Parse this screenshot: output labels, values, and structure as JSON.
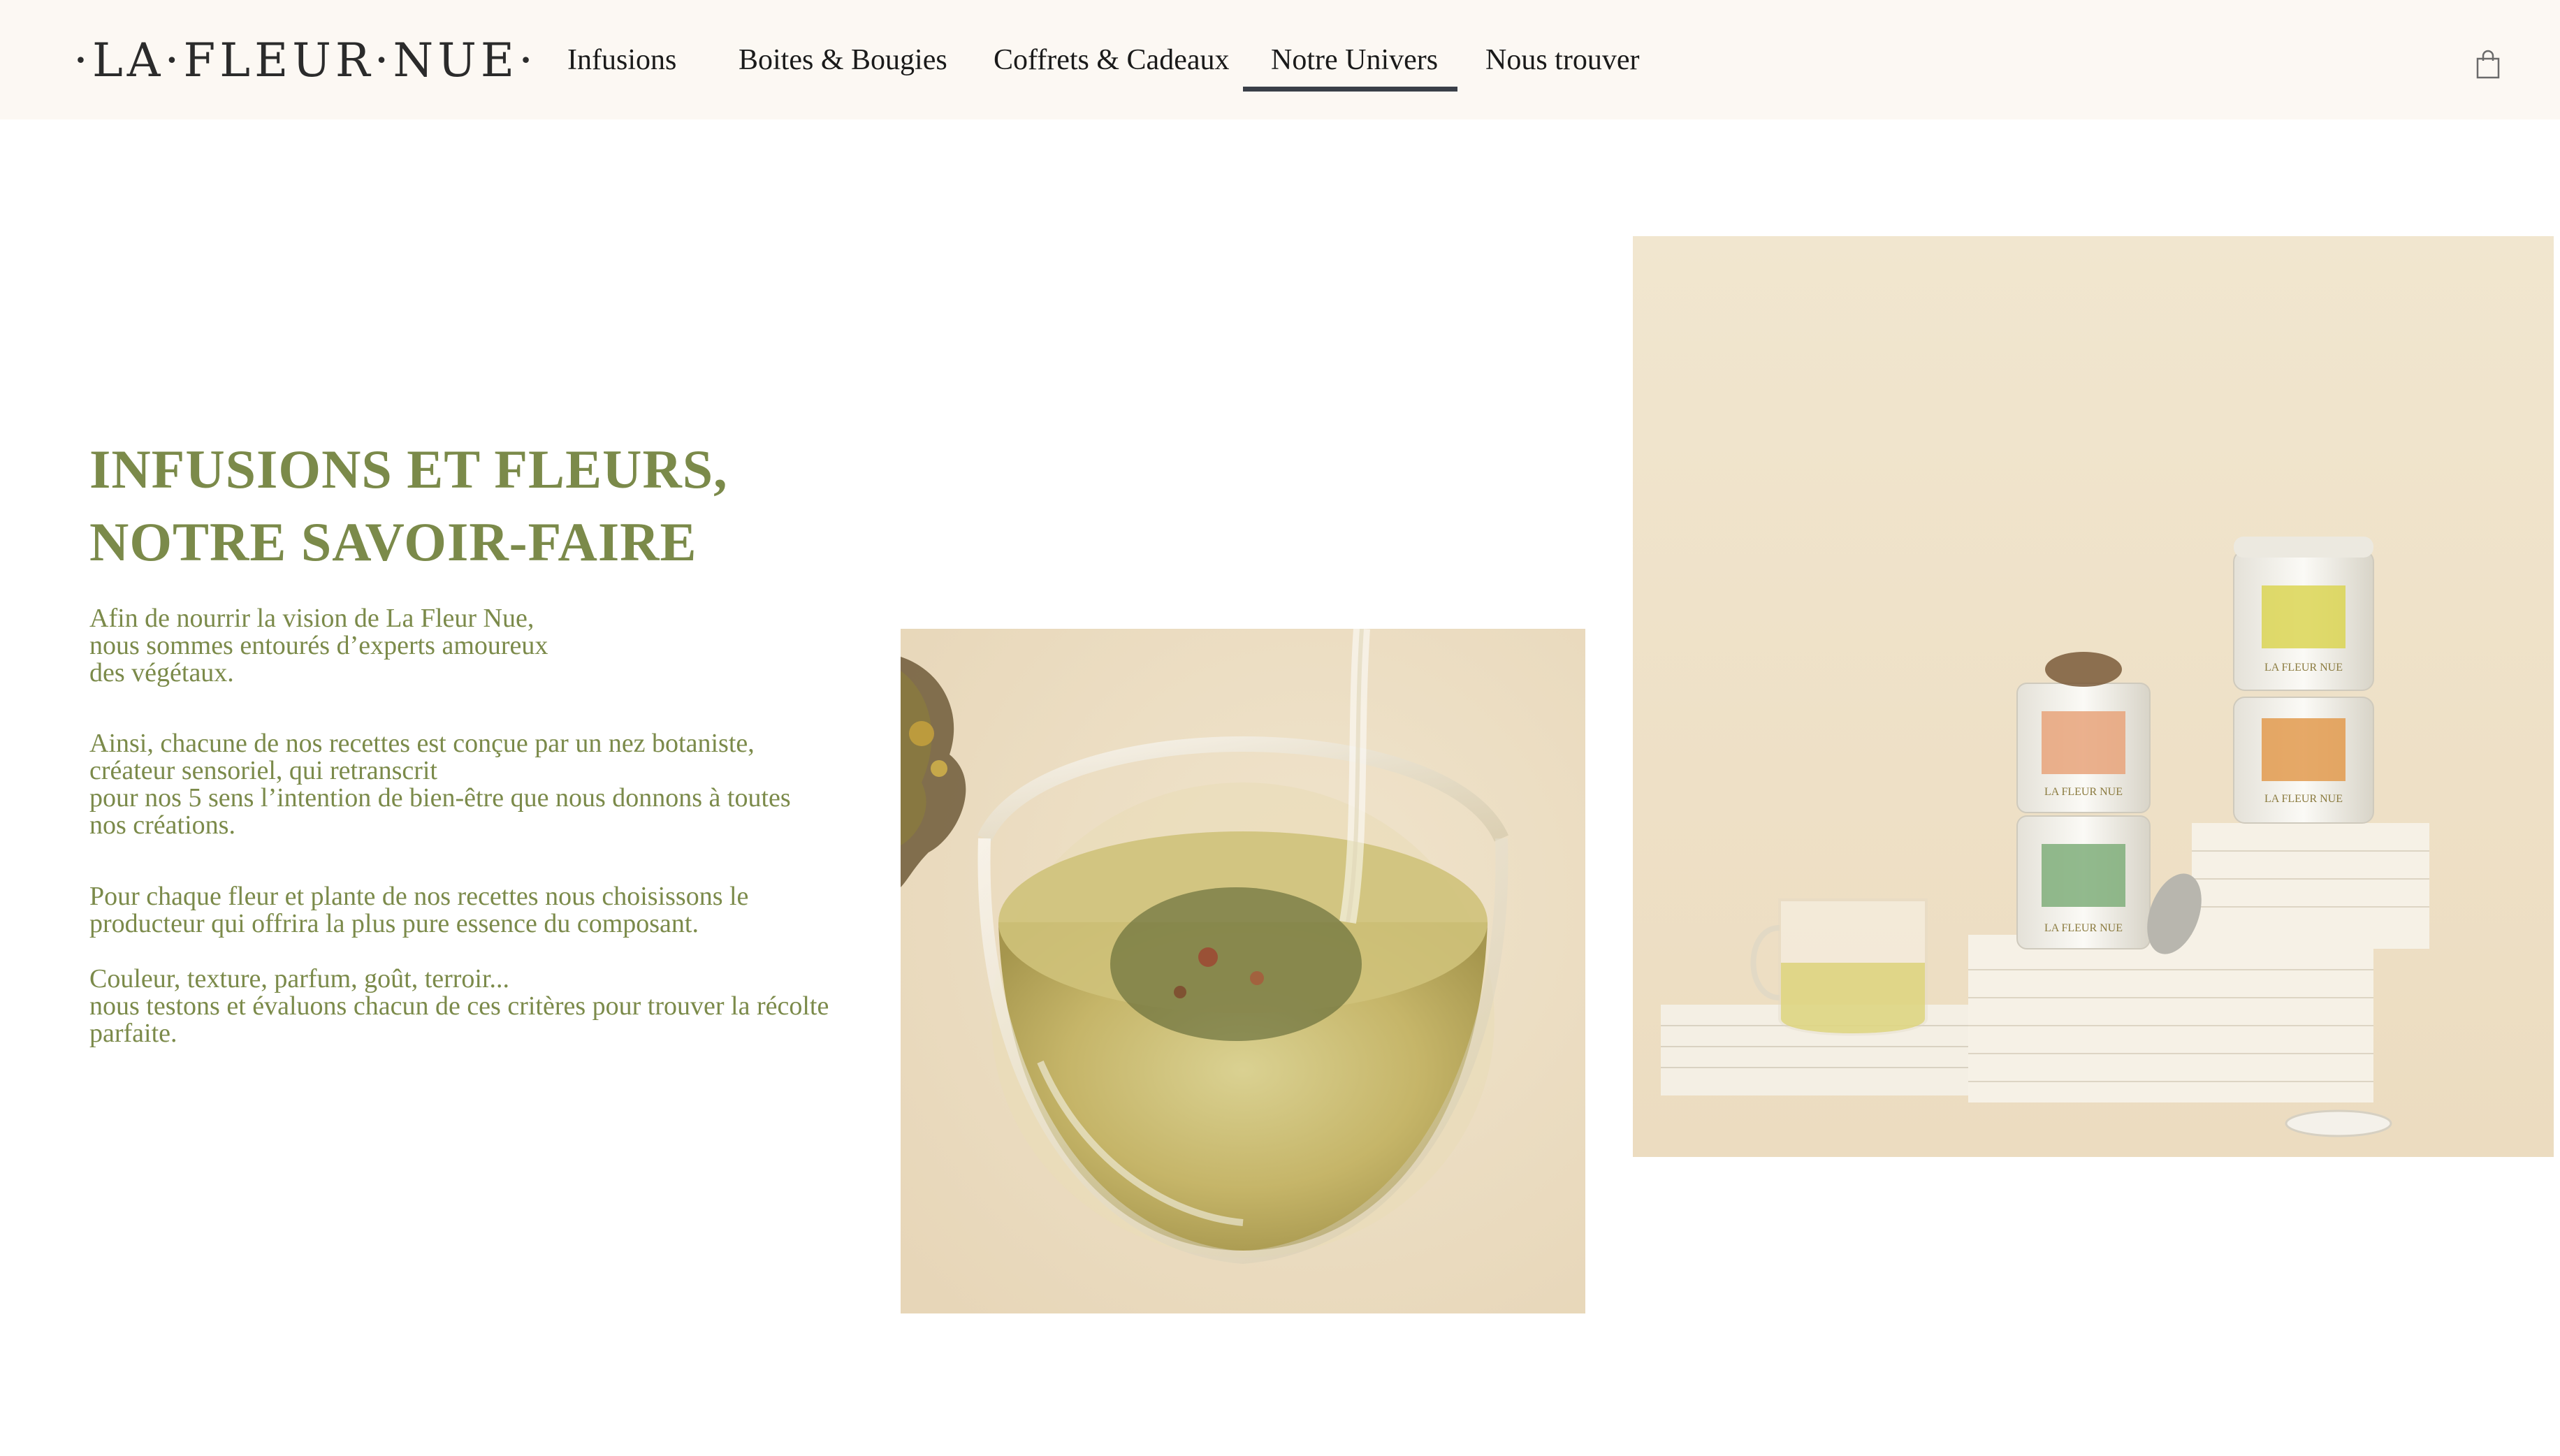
{
  "header": {
    "logo_text": "·LA·FLEUR·NUE·",
    "nav": [
      {
        "label": "Infusions"
      },
      {
        "label": "Boites & Bougies"
      },
      {
        "label": "Coffrets & Cadeaux"
      },
      {
        "label": "Notre Univers",
        "active": true
      },
      {
        "label": "Nous trouver"
      }
    ],
    "cart_icon": "shopping-bag-icon"
  },
  "main": {
    "title_line1": "INFUSIONS ET FLEURS,",
    "title_line2": "NOTRE SAVOIR-FAIRE",
    "paragraphs": [
      "Afin de nourrir la vision de La Fleur Nue,\nnous sommes entourés d’experts amoureux\ndes végétaux.",
      "Ainsi, chacune de nos recettes est conçue par un nez botaniste,\ncréateur sensoriel, qui retranscrit\npour nos 5 sens l’intention de bien-être que nous donnons à toutes\nnos créations.",
      "Pour chaque fleur et plante de  nos recettes nous choisissons le\nproducteur qui offrira la plus pure essence du composant.",
      "Couleur, texture, parfum, goût, terroir...\nnous testons et évaluons chacun de ces critères pour trouver la récolte\nparfaite."
    ],
    "tin_label": "LA FLEUR NUE"
  },
  "colors": {
    "accent": "#7b8a4a",
    "header_bg": "#fcf8f3",
    "nav_underline": "#3a3f48"
  }
}
